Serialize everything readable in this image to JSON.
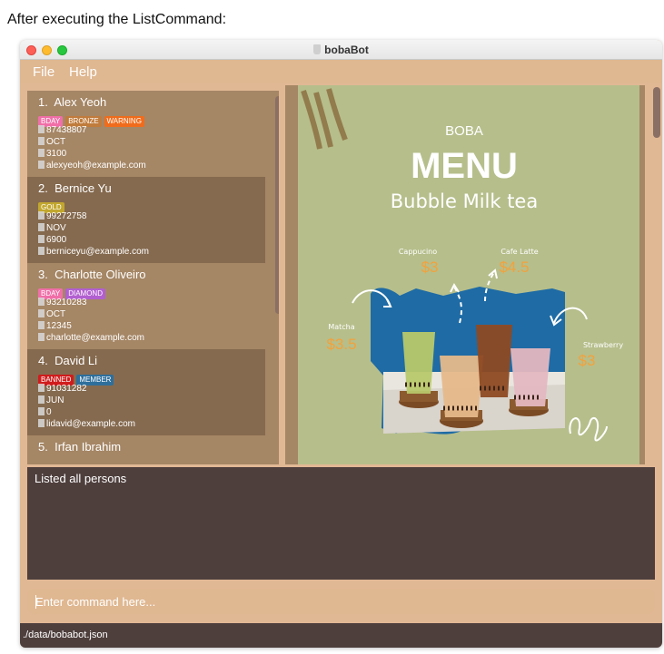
{
  "caption": "After executing the ListCommand:",
  "window": {
    "title": "bobaBot",
    "title_icon": "boba-cup-icon"
  },
  "menu": {
    "file": "File",
    "help": "Help"
  },
  "persons": [
    {
      "index": "1.",
      "name": "Alex Yeoh",
      "tags": [
        {
          "label": "BDAY",
          "color": "#f06fa8"
        },
        {
          "label": "BRONZE",
          "color": "#c07c3c"
        },
        {
          "label": "WARNING",
          "color": "#f06c1c"
        }
      ],
      "phone": "87438807",
      "month": "OCT",
      "points": "3100",
      "email": "alexyeoh@example.com"
    },
    {
      "index": "2.",
      "name": "Bernice Yu",
      "tags": [
        {
          "label": "GOLD",
          "color": "#c2a72e"
        }
      ],
      "phone": "99272758",
      "month": "NOV",
      "points": "6900",
      "email": "berniceyu@example.com"
    },
    {
      "index": "3.",
      "name": "Charlotte Oliveiro",
      "tags": [
        {
          "label": "BDAY",
          "color": "#f06fa8"
        },
        {
          "label": "DIAMOND",
          "color": "#b25fd0"
        }
      ],
      "phone": "93210283",
      "month": "OCT",
      "points": "12345",
      "email": "charlotte@example.com"
    },
    {
      "index": "4.",
      "name": "David Li",
      "tags": [
        {
          "label": "BANNED",
          "color": "#d01c1c"
        },
        {
          "label": "MEMBER",
          "color": "#2e6f9c"
        }
      ],
      "phone": "91031282",
      "month": "JUN",
      "points": "0",
      "email": "lidavid@example.com"
    },
    {
      "index": "5.",
      "name": "Irfan Ibrahim",
      "tags": [],
      "phone": "",
      "month": "",
      "points": "",
      "email": ""
    }
  ],
  "menu_image": {
    "brand": "BOBA",
    "title": "MENU",
    "subtitle": "Bubble Milk tea",
    "items": [
      {
        "name": "Cappucino",
        "price": "$3"
      },
      {
        "name": "Cafe Latte",
        "price": "$4.5"
      },
      {
        "name": "Matcha",
        "price": "$3.5"
      },
      {
        "name": "Strawberry",
        "price": "$3"
      }
    ]
  },
  "result": {
    "text": "Listed all persons"
  },
  "command": {
    "placeholder": "Enter command here..."
  },
  "status": {
    "path": "./data/bobabot.json"
  },
  "colors": {
    "card_light": "#a58665",
    "card_dark": "#856a4f",
    "result_bg": "#4e3f3d",
    "window_bg": "#e1b894",
    "menu_bg": "#b6be8b",
    "price": "#f2a23c"
  }
}
